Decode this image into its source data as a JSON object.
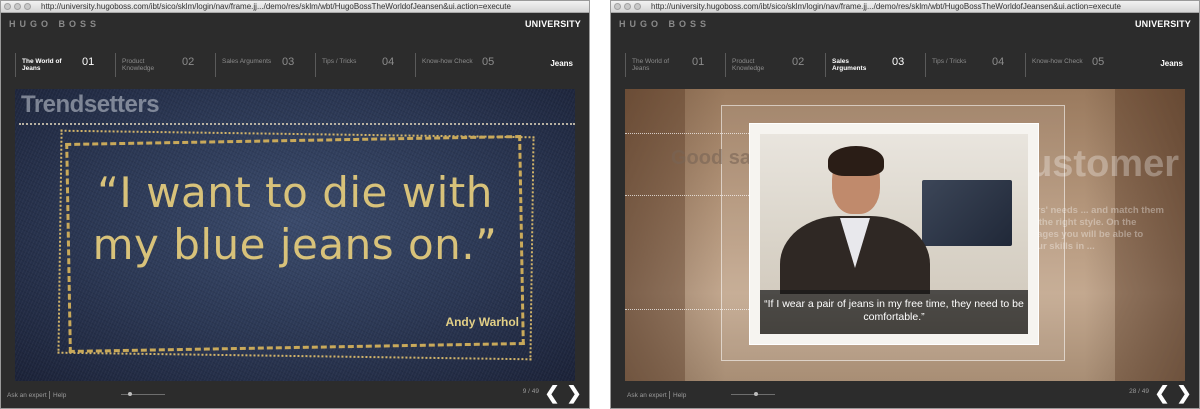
{
  "colors": {
    "app_bg": "#2c2c2c",
    "nav_text": "#8c8c8c",
    "active_text": "#ffffff",
    "stitch_gold": "#d8c27a"
  },
  "left": {
    "url": "http://university.hugoboss.com/ibt/sico/sklm/login/nav/frame.jj.../demo/res/sklm/wbt/HugoBossTheWorldofJeansen&ui.action=execute",
    "brand": "HUGO BOSS",
    "portal": "UNIVERSITY",
    "nav": [
      {
        "label": "The World of Jeans",
        "num": "01"
      },
      {
        "label": "Product Knowledge",
        "num": "02"
      },
      {
        "label": "Sales Arguments",
        "num": "03"
      },
      {
        "label": "Tips / Tricks",
        "num": "04"
      },
      {
        "label": "Know-how Check",
        "num": "05"
      }
    ],
    "nav_final": "Jeans",
    "slide_title": "Trendsetters",
    "quote_line1": "“I want to die with",
    "quote_line2": "my blue jeans on.”",
    "author": "Andy Warhol",
    "footer": {
      "ask": "Ask an expert",
      "help": "Help",
      "page": "9 / 49"
    },
    "progress": 0.18
  },
  "right": {
    "url": "http://university.hugoboss.com/ibt/sico/sklm/login/nav/frame.jj.../demo/res/sklm/wbt/HugoBossTheWorldofJeansen&ui.action=execute",
    "brand": "HUGO BOSS",
    "portal": "UNIVERSITY",
    "nav": [
      {
        "label": "The World of Jeans",
        "num": "01"
      },
      {
        "label": "Product Knowledge",
        "num": "02"
      },
      {
        "label": "Sales Arguments",
        "num": "03"
      },
      {
        "label": "Tips / Tricks",
        "num": "04"
      },
      {
        "label": "Know-how Check",
        "num": "05"
      }
    ],
    "nav_final": "Jeans",
    "ghost_heading": "Customer",
    "ghost_left": "Good salespeople ... their",
    "ghost_body": "... customers' needs ... and match them with ... and the right style. On the following pages you will be able to practice your skills in ...",
    "caption": "“If I wear a pair of jeans in my free time, they need to be comfortable.”",
    "footer": {
      "ask": "Ask an expert",
      "help": "Help",
      "page": "28 / 49"
    },
    "progress": 0.57
  },
  "icons": {
    "prev": "❮",
    "next": "❯"
  }
}
